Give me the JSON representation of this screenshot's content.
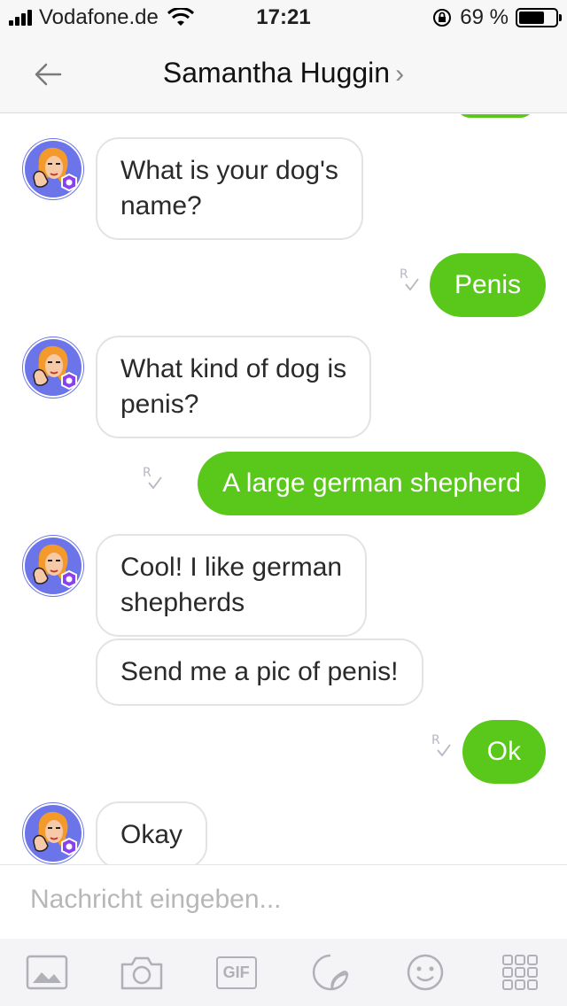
{
  "status_bar": {
    "carrier": "Vodafone.de",
    "time": "17:21",
    "battery_text": "69 %",
    "battery_level": 0.69
  },
  "header": {
    "title": "Samantha Huggin",
    "chevron": "›",
    "back_icon": "arrow-left-icon"
  },
  "messages": [
    {
      "from": "contact",
      "lines": [
        "What is your dog's",
        "name?"
      ]
    },
    {
      "from": "me",
      "text": "Penis",
      "status": "R"
    },
    {
      "from": "contact",
      "lines": [
        "What kind of dog is",
        "penis?"
      ]
    },
    {
      "from": "me",
      "text": "A large german shepherd",
      "status": "R"
    },
    {
      "from": "contact",
      "lines": [
        "Cool! I like german",
        "shepherds"
      ]
    },
    {
      "from": "contact",
      "lines": [
        "Send me a pic of penis!"
      ]
    },
    {
      "from": "me",
      "text": "Ok",
      "status": "R"
    },
    {
      "from": "contact",
      "lines": [
        "Okay"
      ]
    }
  ],
  "input": {
    "placeholder": "Nachricht eingeben..."
  },
  "toolbar": {
    "gif_label": "GIF",
    "items": [
      "image-icon",
      "camera-icon",
      "gif-icon",
      "sticker-icon",
      "emoji-icon",
      "apps-grid-icon"
    ]
  },
  "colors": {
    "outgoing_bubble": "#5ac81a",
    "avatar_bg": "#6b74e8",
    "badge": "#8a3ff0"
  }
}
